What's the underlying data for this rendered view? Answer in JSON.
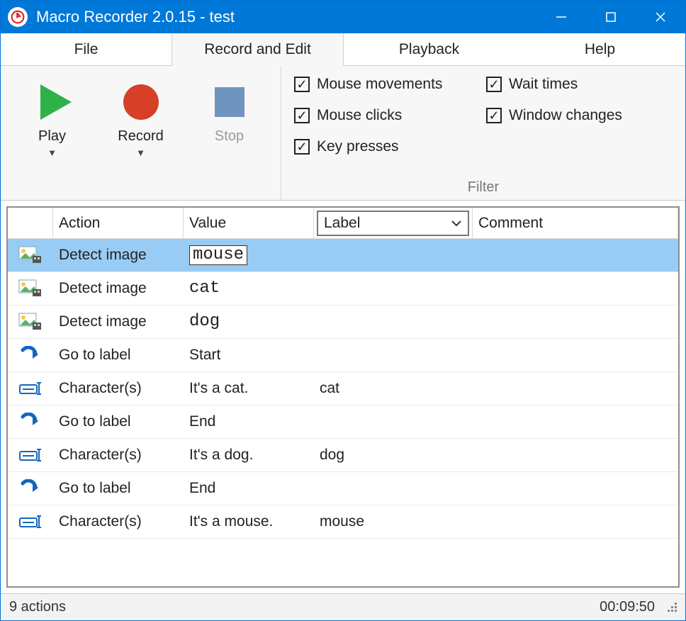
{
  "titlebar": {
    "title": "Macro Recorder 2.0.15 - test"
  },
  "menu": {
    "tabs": [
      "File",
      "Record and Edit",
      "Playback",
      "Help"
    ],
    "active_index": 1
  },
  "ribbon": {
    "controls": {
      "play": {
        "label": "Play",
        "icon": "play-icon"
      },
      "record": {
        "label": "Record",
        "icon": "record-icon"
      },
      "stop": {
        "label": "Stop",
        "icon": "stop-icon",
        "disabled": true
      }
    },
    "filter": {
      "caption": "Filter",
      "options": [
        {
          "label": "Mouse movements",
          "checked": true
        },
        {
          "label": "Wait times",
          "checked": true
        },
        {
          "label": "Mouse clicks",
          "checked": true
        },
        {
          "label": "Window changes",
          "checked": true
        },
        {
          "label": "Key presses",
          "checked": true
        }
      ]
    }
  },
  "grid": {
    "headers": {
      "action": "Action",
      "value": "Value",
      "label": "Label",
      "comment": "Comment"
    },
    "rows": [
      {
        "icon": "detect-image-icon",
        "action": "Detect image",
        "value": "mouse",
        "value_style": "box",
        "label": "",
        "comment": "",
        "selected": true
      },
      {
        "icon": "detect-image-icon",
        "action": "Detect image",
        "value": "cat",
        "value_style": "mono",
        "label": "",
        "comment": ""
      },
      {
        "icon": "detect-image-icon",
        "action": "Detect image",
        "value": "dog",
        "value_style": "mono",
        "label": "",
        "comment": ""
      },
      {
        "icon": "goto-icon",
        "action": "Go to label",
        "value": "Start",
        "value_style": "plain",
        "label": "",
        "comment": ""
      },
      {
        "icon": "characters-icon",
        "action": "Character(s)",
        "value": "It's a cat.",
        "value_style": "plain",
        "label": "cat",
        "comment": ""
      },
      {
        "icon": "goto-icon",
        "action": "Go to label",
        "value": "End",
        "value_style": "plain",
        "label": "",
        "comment": ""
      },
      {
        "icon": "characters-icon",
        "action": "Character(s)",
        "value": "It's a dog.",
        "value_style": "plain",
        "label": "dog",
        "comment": ""
      },
      {
        "icon": "goto-icon",
        "action": "Go to label",
        "value": "End",
        "value_style": "plain",
        "label": "",
        "comment": ""
      },
      {
        "icon": "characters-icon",
        "action": "Character(s)",
        "value": "It's a mouse.",
        "value_style": "plain",
        "label": "mouse",
        "comment": ""
      }
    ]
  },
  "statusbar": {
    "count": "9 actions",
    "time": "00:09:50"
  }
}
